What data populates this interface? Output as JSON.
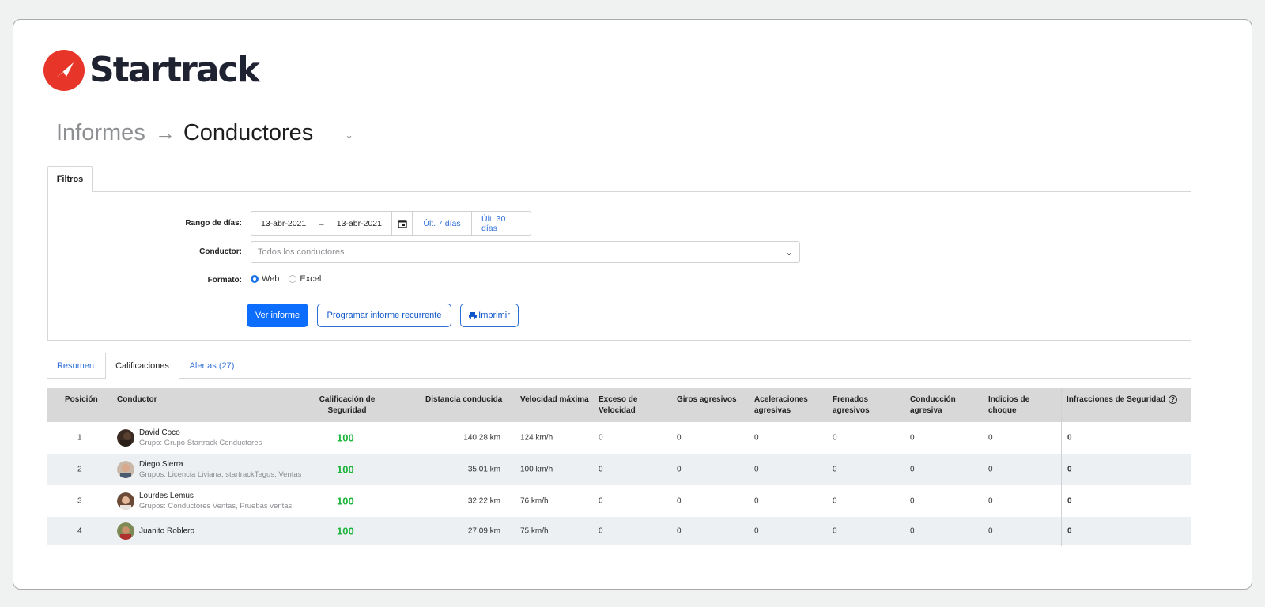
{
  "brand": {
    "name": "Startrack",
    "accent_color": "#e8352a"
  },
  "breadcrumb": {
    "parent": "Informes",
    "current": "Conductores"
  },
  "filters": {
    "tab_label": "Filtros",
    "date_range_label": "Rango de días:",
    "date_from": "13-abr-2021",
    "date_to": "13-abr-2021",
    "quick_7": "Últ. 7 días",
    "quick_30": "Últ. 30 días",
    "driver_label": "Conductor:",
    "driver_placeholder": "Todos los conductores",
    "format_label": "Formato:",
    "format_options": [
      "Web",
      "Excel"
    ],
    "format_selected": "Web",
    "btn_view": "Ver informe",
    "btn_schedule": "Programar informe recurrente",
    "btn_print": "Imprimir"
  },
  "tabs": {
    "resumen": "Resumen",
    "calificaciones": "Calificaciones",
    "alertas": "Alertas (27)",
    "active": "Calificaciones"
  },
  "table": {
    "headers": {
      "posicion": "Posición",
      "conductor": "Conductor",
      "calificacion_1": "Calificación de",
      "calificacion_2": "Seguridad",
      "distancia": "Distancia conducida",
      "velocidad": "Velocidad máxima",
      "exceso_1": "Exceso de",
      "exceso_2": "Velocidad",
      "giros": "Giros agresivos",
      "aceleraciones_1": "Aceleraciones",
      "aceleraciones_2": "agresivas",
      "frenados_1": "Frenados",
      "frenados_2": "agresivos",
      "conduccion_1": "Conducción",
      "conduccion_2": "agresiva",
      "indicios_1": "Indicios de",
      "indicios_2": "choque",
      "infracciones": "Infracciones de Seguridad"
    },
    "rows": [
      {
        "pos": "1",
        "name": "David Coco",
        "group": "Grupo: Grupo Startrack Conductores",
        "score": "100",
        "distance": "140.28 km",
        "speed": "124 km/h",
        "exceso": "0",
        "giros": "0",
        "acel": "0",
        "fren": "0",
        "cond": "0",
        "choque": "0",
        "infr": "0"
      },
      {
        "pos": "2",
        "name": "Diego Sierra",
        "group": "Grupos: Licencia Liviana, startrackTegus, Ventas",
        "score": "100",
        "distance": "35.01 km",
        "speed": "100 km/h",
        "exceso": "0",
        "giros": "0",
        "acel": "0",
        "fren": "0",
        "cond": "0",
        "choque": "0",
        "infr": "0"
      },
      {
        "pos": "3",
        "name": "Lourdes Lemus",
        "group": "Grupos: Conductores Ventas, Pruebas ventas",
        "score": "100",
        "distance": "32.22 km",
        "speed": "76 km/h",
        "exceso": "0",
        "giros": "0",
        "acel": "0",
        "fren": "0",
        "cond": "0",
        "choque": "0",
        "infr": "0"
      },
      {
        "pos": "4",
        "name": "Juanito Roblero",
        "group": "",
        "score": "100",
        "distance": "27.09 km",
        "speed": "75 km/h",
        "exceso": "0",
        "giros": "0",
        "acel": "0",
        "fren": "0",
        "cond": "0",
        "choque": "0",
        "infr": "0"
      }
    ]
  }
}
